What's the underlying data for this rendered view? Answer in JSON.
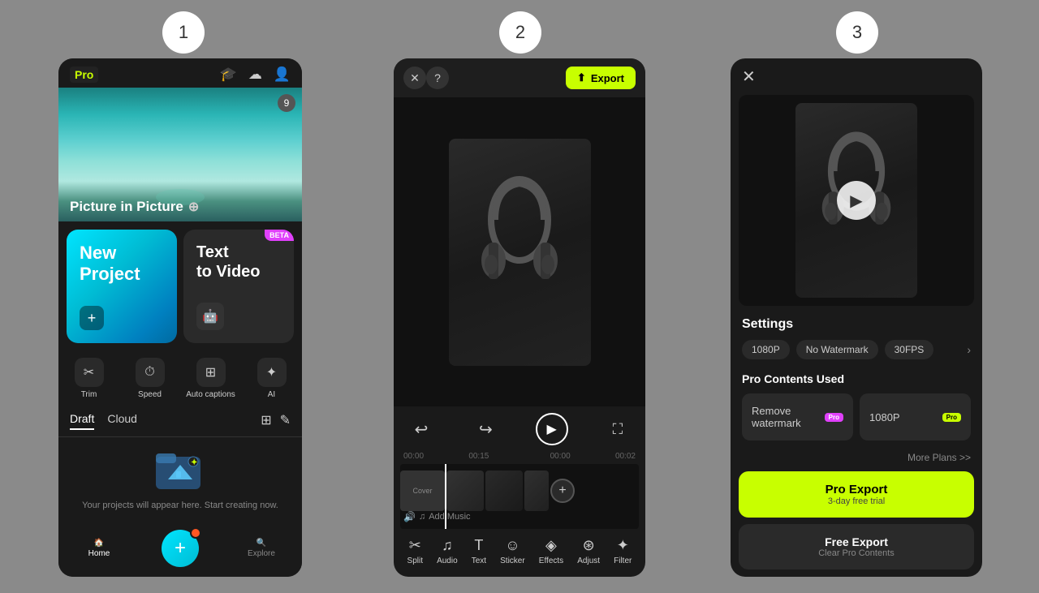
{
  "steps": [
    {
      "number": "1"
    },
    {
      "number": "2"
    },
    {
      "number": "3"
    }
  ],
  "phone1": {
    "pro_label": "Pro",
    "hero_title": "Picture in Picture",
    "hero_count": "9",
    "new_project": "New\nProject",
    "text_to_video": "Text\nto Video",
    "beta": "BETA",
    "tools": [
      {
        "label": "Trim",
        "icon": "✂"
      },
      {
        "label": "Speed",
        "icon": "⏱"
      },
      {
        "label": "Auto captions",
        "icon": "⊞"
      },
      {
        "label": "AI",
        "icon": "✦"
      }
    ],
    "tab_draft": "Draft",
    "tab_cloud": "Cloud",
    "empty_text": "Your projects will appear here. Start creating now.",
    "nav_home": "Home",
    "nav_explore": "Explore"
  },
  "phone2": {
    "close_label": "✕",
    "help_label": "?",
    "export_label": "Export",
    "time_start": "00:00",
    "time_total": "00:15",
    "time_mid1": "00:00",
    "time_mid2": "00:02",
    "cover_label": "Cover",
    "add_music_label": "Add Music",
    "tools": [
      {
        "label": "Split",
        "icon": "✂"
      },
      {
        "label": "Audio",
        "icon": "♫"
      },
      {
        "label": "Text",
        "icon": "T"
      },
      {
        "label": "Sticker",
        "icon": "☺"
      },
      {
        "label": "Effects",
        "icon": "◈"
      },
      {
        "label": "Adjust",
        "icon": "⊛"
      },
      {
        "label": "Filter",
        "icon": "✦"
      }
    ]
  },
  "phone3": {
    "close_label": "✕",
    "settings_title": "Settings",
    "resolution_1080": "1080P",
    "no_watermark": "No Watermark",
    "fps_30": "30FPS",
    "pro_contents_title": "Pro Contents Used",
    "remove_watermark": "Remove watermark",
    "resolution_label": "1080P",
    "more_plans": "More Plans >>",
    "pro_export_label": "Pro Export",
    "pro_trial_label": "3-day free trial",
    "free_export_label": "Free Export",
    "free_clear_label": "Clear Pro Contents"
  }
}
